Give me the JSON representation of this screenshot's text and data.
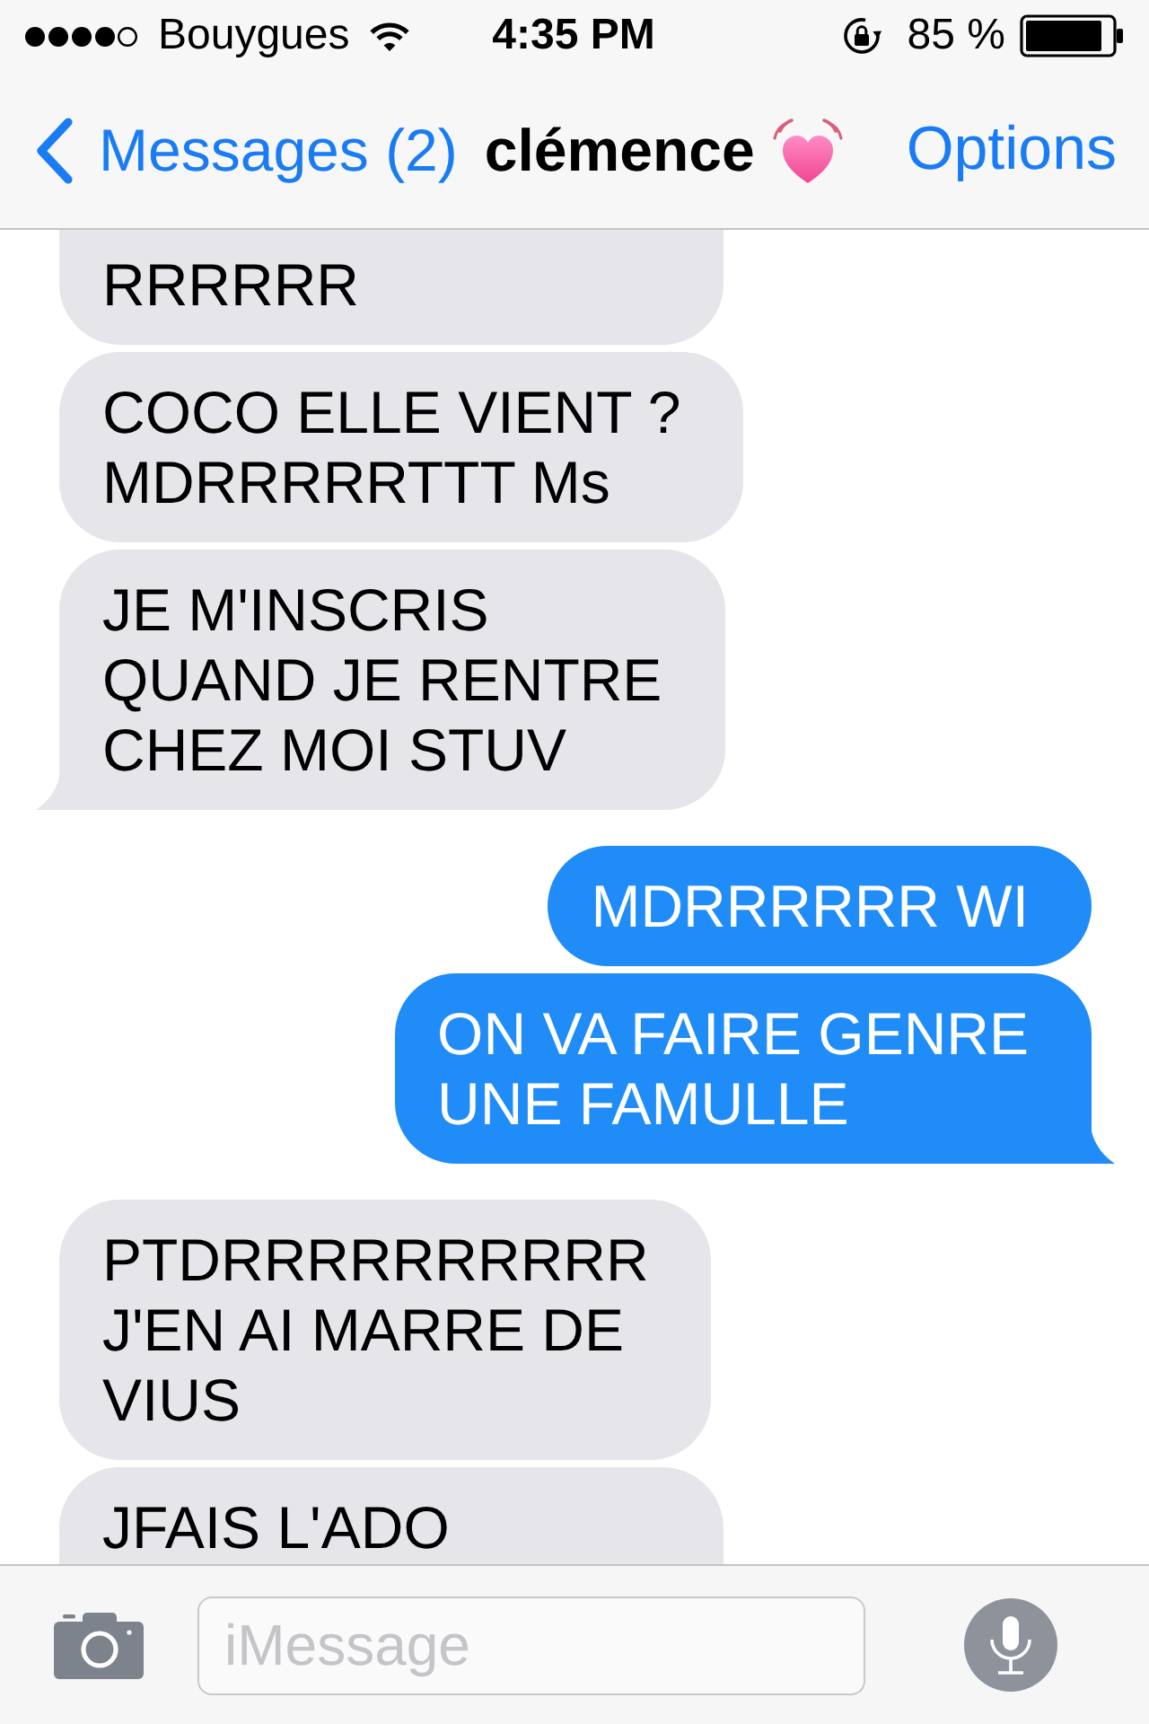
{
  "status_bar": {
    "carrier": "Bouygues",
    "time": "4:35 PM",
    "battery": "85 %"
  },
  "nav_bar": {
    "back_label": "Messages (2)",
    "title": "clémence",
    "action": "Options"
  },
  "messages": [
    {
      "kind": "received",
      "text": "RRRRRR",
      "tail": false
    },
    {
      "kind": "received",
      "text": "COCO ELLE VIENT ?\nMDRRRRRTTT Ms",
      "tail": false
    },
    {
      "kind": "received",
      "text": "JE M'INSCRIS\nQUAND JE RENTRE\nCHEZ MOI STUV",
      "tail": true
    },
    {
      "kind": "sent",
      "text": "MDRRRRRR WI",
      "tail": false
    },
    {
      "kind": "sent",
      "text": "ON VA FAIRE GENRE\nUNE FAMULLE",
      "tail": true
    },
    {
      "kind": "received",
      "text": "PTDRRRRRRRRRR\nJ'EN AI MARRE DE\nVIUS",
      "tail": false
    },
    {
      "kind": "received",
      "text": "JFAIS L'ADO",
      "tail": false
    }
  ],
  "input_bar": {
    "placeholder": "iMessage"
  }
}
